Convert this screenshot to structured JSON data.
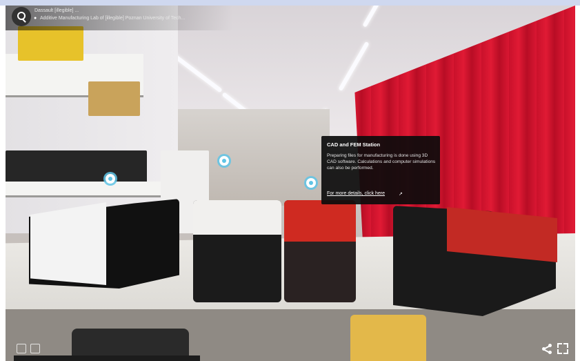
{
  "viewer": {
    "space_subtitle": "Dassault [illegible] ...",
    "location_label": "Additive Manufacturing Lab of [illegible] Poznan University of Tech...",
    "search_label": "Search"
  },
  "tooltip": {
    "title": "CAD and FEM Station",
    "body": "Preparing files for manufacturing is done using 3D CAD software. Calculations and computer simulations can also be performed.",
    "link_text": "For more details, click here",
    "link_icon": "external-link-icon"
  },
  "controls": {
    "share_icon": "share-icon",
    "fullscreen_icon": "fullscreen-icon"
  },
  "colors": {
    "marker_accent": "#5fc4e6",
    "curtain_red": "#d91732",
    "tooltip_bg": "#0c0c0c"
  }
}
